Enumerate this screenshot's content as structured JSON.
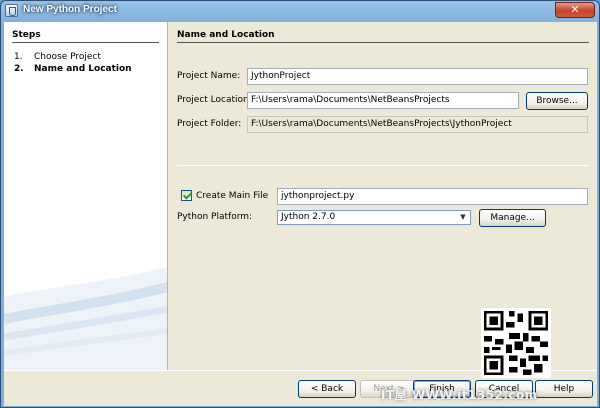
{
  "window": {
    "title": "New Python Project",
    "close_glyph": "✕"
  },
  "steps": {
    "title": "Steps",
    "items": [
      {
        "num": "1.",
        "label": "Choose Project"
      },
      {
        "num": "2.",
        "label": "Name and Location"
      }
    ]
  },
  "main": {
    "section_title": "Name and Location",
    "project_name": {
      "label": "Project Name:",
      "value": "JythonProject"
    },
    "project_location": {
      "label": "Project Location:",
      "value": "F:\\Users\\rama\\Documents\\NetBeansProjects",
      "browse_label": "Browse..."
    },
    "project_folder": {
      "label": "Project Folder:",
      "value": "F:\\Users\\rama\\Documents\\NetBeansProjects\\JythonProject"
    },
    "create_main_file": {
      "label": "Create Main File",
      "checked": true,
      "value": "jythonproject.py"
    },
    "python_platform": {
      "label": "Python Platform:",
      "selected": "Jython 2.7.0",
      "manage_label": "Manage..."
    }
  },
  "footer": {
    "back_label": "< Back",
    "next_label": "Next >",
    "finish_label": "Finish",
    "cancel_label": "Cancel",
    "help_label": "Help"
  },
  "overlay": {
    "watermark_text": "IT屋 WWW.it1352.com"
  },
  "icons": {
    "window": "python-project-icon",
    "check": "check-icon",
    "dropdown": "chevron-down-icon"
  },
  "colors": {
    "title_bar": "#7fb0db",
    "dialog_bg": "#ece9d8",
    "close_button": "#c2432a"
  }
}
